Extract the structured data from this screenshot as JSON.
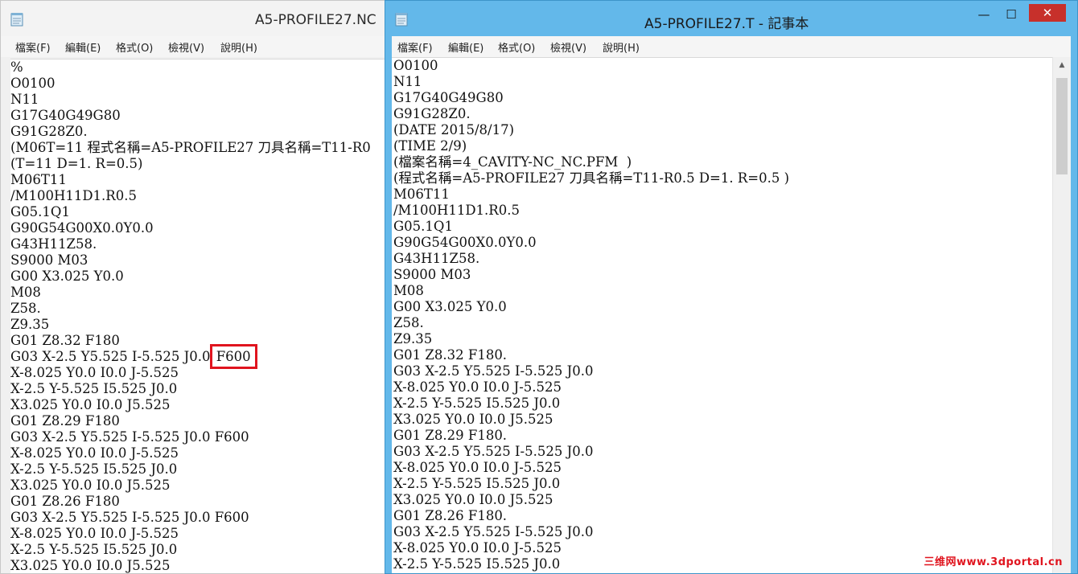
{
  "back_window": {
    "title": "A5-PROFILE27.NC",
    "menu": [
      "檔案(F)",
      "編輯(E)",
      "格式(O)",
      "檢視(V)",
      "說明(H)"
    ],
    "lines": [
      "%",
      "O0100",
      "N11",
      "G17G40G49G80",
      "G91G28Z0.",
      "(M06T=11 程式名稱=A5-PROFILE27 刀具名稱=T11-R0",
      "(T=11 D=1. R=0.5)",
      "M06T11",
      "/M100H11D1.R0.5",
      "G05.1Q1",
      "G90G54G00X0.0Y0.0",
      "G43H11Z58.",
      "S9000 M03",
      "G00 X3.025 Y0.0",
      "M08",
      "Z58.",
      "Z9.35",
      "G01 Z8.32 F180",
      "G03 X-2.5 Y5.525 I-5.525 J0.0 ",
      "X-8.025 Y0.0 I0.0 J-5.525",
      "X-2.5 Y-5.525 I5.525 J0.0",
      "X3.025 Y0.0 I0.0 J5.525",
      "G01 Z8.29 F180",
      "G03 X-2.5 Y5.525 I-5.525 J0.0 F600",
      "X-8.025 Y0.0 I0.0 J-5.525",
      "X-2.5 Y-5.525 I5.525 J0.0",
      "X3.025 Y0.0 I0.0 J5.525",
      "G01 Z8.26 F180",
      "G03 X-2.5 Y5.525 I-5.525 J0.0 F600",
      "X-8.025 Y0.0 I0.0 J-5.525",
      "X-2.5 Y-5.525 I5.525 J0.0",
      "X3.025 Y0.0 I0.0 J5.525"
    ],
    "highlight_text": "F600"
  },
  "front_window": {
    "title": "A5-PROFILE27.T - 記事本",
    "menu": [
      "檔案(F)",
      "編輯(E)",
      "格式(O)",
      "檢視(V)",
      "說明(H)"
    ],
    "lines": [
      "O0100",
      "N11",
      "G17G40G49G80",
      "G91G28Z0.",
      "(DATE 2015/8/17)",
      "(TIME 2/9)",
      "(檔案名稱=4_CAVITY-NC_NC.PFM  )",
      "(程式名稱=A5-PROFILE27 刀具名稱=T11-R0.5 D=1. R=0.5 )",
      "M06T11",
      "/M100H11D1.R0.5",
      "G05.1Q1",
      "G90G54G00X0.0Y0.0",
      "G43H11Z58.",
      "S9000 M03",
      "M08",
      "G00 X3.025 Y0.0",
      "Z58.",
      "Z9.35",
      "G01 Z8.32 F180.",
      "G03 X-2.5 Y5.525 I-5.525 J0.0",
      "X-8.025 Y0.0 I0.0 J-5.525",
      "X-2.5 Y-5.525 I5.525 J0.0",
      "X3.025 Y0.0 I0.0 J5.525",
      "G01 Z8.29 F180.",
      "G03 X-2.5 Y5.525 I-5.525 J0.0",
      "X-8.025 Y0.0 I0.0 J-5.525",
      "X-2.5 Y-5.525 I5.525 J0.0",
      "X3.025 Y0.0 I0.0 J5.525",
      "G01 Z8.26 F180.",
      "G03 X-2.5 Y5.525 I-5.525 J0.0",
      "X-8.025 Y0.0 I0.0 J-5.525",
      "X-2.5 Y-5.525 I5.525 J0.0"
    ],
    "controls": {
      "minimize": "—",
      "maximize": "☐",
      "close": "✕"
    }
  },
  "watermark": "三维网www.3dportal.cn",
  "icons": [
    "notepad-icon",
    "minimize-icon",
    "maximize-icon",
    "close-icon",
    "scroll-up-icon",
    "scroll-down-icon"
  ],
  "colors": {
    "titlebar_active": "#63b8ea",
    "close_button": "#c7302b",
    "highlight_box": "#e0141e"
  }
}
